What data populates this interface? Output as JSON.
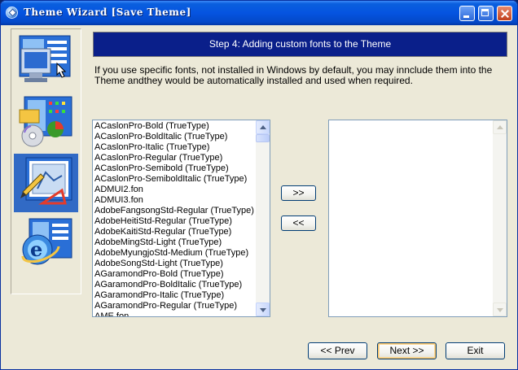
{
  "window": {
    "title": "Theme Wizard [Save Theme]"
  },
  "sidebar": {
    "steps": [
      {
        "icon": "monitor-settings-icon",
        "active": false
      },
      {
        "icon": "theme-components-icon",
        "active": false
      },
      {
        "icon": "fonts-drawing-icon",
        "active": true
      },
      {
        "icon": "internet-explorer-icon",
        "active": false
      }
    ]
  },
  "step": {
    "title": "Step 4: Adding custom fonts to the Theme",
    "description": "If you use specific fonts, not installed in Windows by default, you may innclude them into the Theme andthey would be automatically installed and used when required."
  },
  "available_fonts": [
    "ACaslonPro-Bold (TrueType)",
    "ACaslonPro-BoldItalic (TrueType)",
    "ACaslonPro-Italic (TrueType)",
    "ACaslonPro-Regular (TrueType)",
    "ACaslonPro-Semibold (TrueType)",
    "ACaslonPro-SemiboldItalic (TrueType)",
    "ADMUI2.fon",
    "ADMUI3.fon",
    "AdobeFangsongStd-Regular (TrueType)",
    "AdobeHeitiStd-Regular (TrueType)",
    "AdobeKaitiStd-Regular (TrueType)",
    "AdobeMingStd-Light (TrueType)",
    "AdobeMyungjoStd-Medium (TrueType)",
    "AdobeSongStd-Light (TrueType)",
    "AGaramondPro-Bold (TrueType)",
    "AGaramondPro-BoldItalic (TrueType)",
    "AGaramondPro-Italic (TrueType)",
    "AGaramondPro-Regular (TrueType)",
    "AME.fon"
  ],
  "selected_fonts": [],
  "buttons": {
    "add": ">>",
    "remove": "<<",
    "prev": "<< Prev",
    "next": "Next >>",
    "exit": "Exit"
  }
}
